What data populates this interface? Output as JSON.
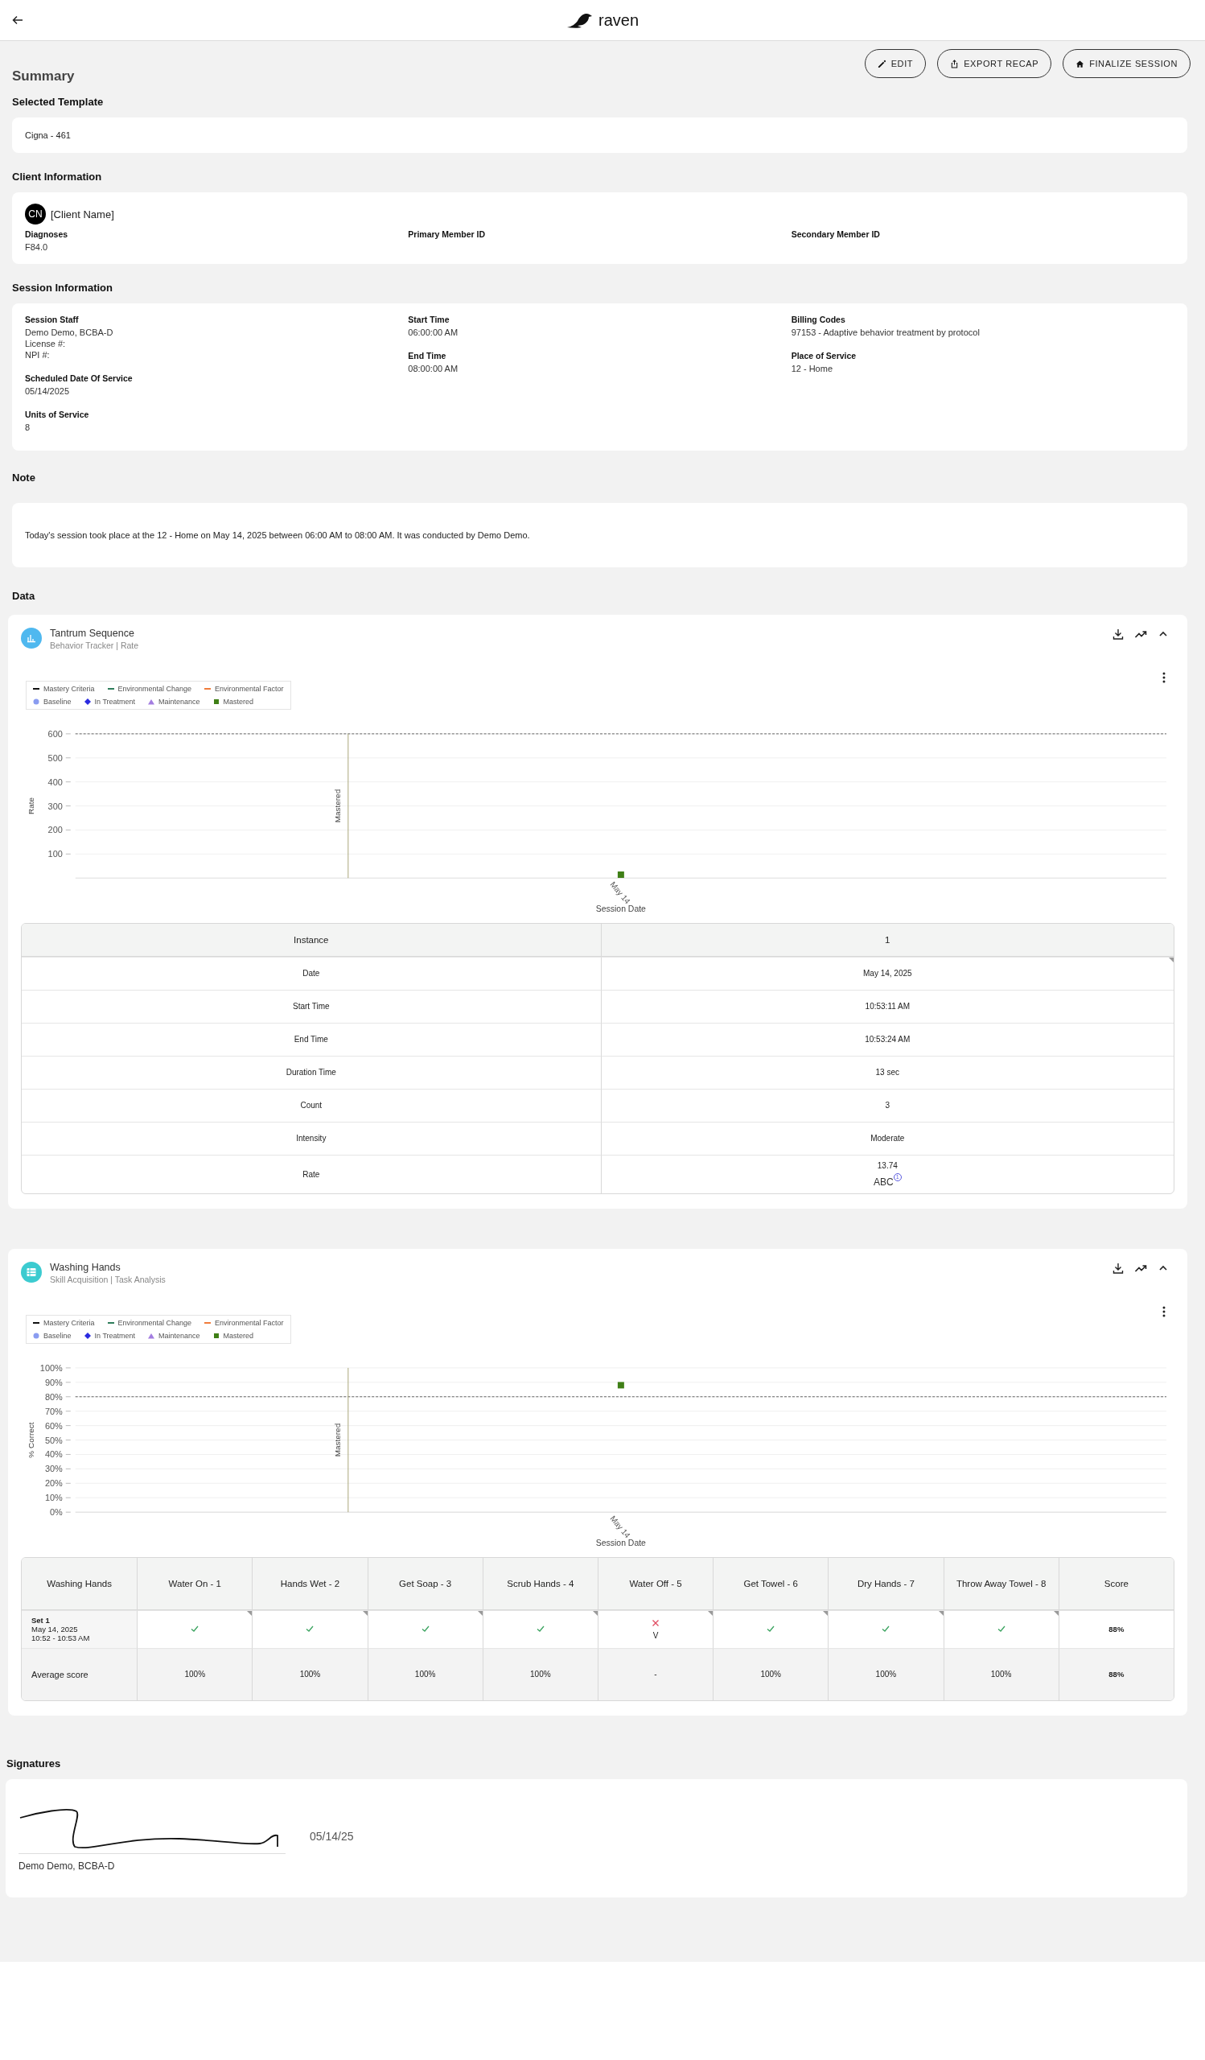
{
  "header": {
    "brand": "raven"
  },
  "actions": [
    {
      "label": "EDIT"
    },
    {
      "label": "EXPORT RECAP"
    },
    {
      "label": "FINALIZE SESSION"
    }
  ],
  "page_title": "Summary",
  "selected_template": {
    "heading": "Selected Template",
    "value": "Cigna - 461"
  },
  "client": {
    "heading": "Client Information",
    "initials": "CN",
    "name": "[Client Name]",
    "fields": [
      {
        "label": "Diagnoses",
        "lines": [
          "F84.0"
        ]
      },
      {
        "label": "Primary Member ID"
      },
      {
        "label": "Secondary Member ID"
      }
    ]
  },
  "session": {
    "heading": "Session Information",
    "columns": [
      {
        "fields": [
          {
            "label": "Session Staff",
            "lines": [
              "Demo Demo, BCBA-D",
              "License #:",
              "NPI #:"
            ]
          },
          {
            "label": "Scheduled Date Of Service",
            "lines": [
              "05/14/2025"
            ]
          },
          {
            "label": "Units of Service",
            "lines": [
              "8"
            ]
          }
        ]
      },
      {
        "fields": [
          {
            "label": "Start Time",
            "lines": [
              "06:00:00 AM"
            ]
          },
          {
            "label": "End Time",
            "lines": [
              "08:00:00 AM"
            ]
          }
        ]
      },
      {
        "fields": [
          {
            "label": "Billing Codes",
            "lines": [
              "97153 - Adaptive behavior treatment by protocol"
            ]
          },
          {
            "label": "Place of Service",
            "lines": [
              "12 - Home"
            ]
          }
        ]
      }
    ]
  },
  "note": {
    "heading": "Note",
    "text": "Today's session took place at the 12 - Home on May 14, 2025 between 06:00 AM to 08:00 AM. It was conducted by Demo Demo."
  },
  "data": {
    "heading": "Data",
    "trackers": [
      {
        "kind": "behavior",
        "title": "Tantrum Sequence",
        "subtitle": "Behavior Tracker | Rate",
        "legend": [
          [
            {
              "kind": "line",
              "label": "Mastery Criteria",
              "color": "#111111"
            },
            {
              "kind": "line",
              "label": "Environmental Change",
              "color": "#2e7d5b"
            },
            {
              "kind": "line",
              "label": "Environmental Factor",
              "color": "#f07c3c"
            }
          ],
          [
            {
              "kind": "circle",
              "label": "Baseline",
              "color": "#8a9cf0"
            },
            {
              "kind": "diamond",
              "label": "In Treatment",
              "color": "#2a2ae0"
            },
            {
              "kind": "triangle",
              "label": "Maintenance",
              "color": "#a37de0"
            },
            {
              "kind": "square",
              "label": "Mastered",
              "color": "#3f7f16"
            }
          ]
        ],
        "chart_data": {
          "type": "scatter",
          "xlabel": "Session Date",
          "ylabel": "Rate",
          "categories": [
            "May 14"
          ],
          "series": [
            {
              "color": "#3f7f16",
              "values": [
                14
              ]
            }
          ],
          "ylim": [
            0,
            600
          ],
          "yticks": [
            100,
            200,
            300,
            400,
            500,
            600
          ],
          "grid": true,
          "ref_lines": [
            {
              "axis": "y",
              "value": 600
            }
          ],
          "annotations": [
            {
              "text": "Mastered"
            }
          ]
        },
        "table": {
          "kind": "instances",
          "columns": [
            "Instance",
            "1"
          ],
          "rows": [
            {
              "label": "Date",
              "value": "May 14, 2025",
              "flagged": true
            },
            {
              "label": "Start Time",
              "value": "10:53:11 AM",
              "flagged": false
            },
            {
              "label": "End Time",
              "value": "10:53:24 AM",
              "flagged": false
            },
            {
              "label": "Duration Time",
              "value": "13 sec",
              "flagged": false
            },
            {
              "label": "Count",
              "value": "3",
              "flagged": false
            },
            {
              "label": "Intensity",
              "value": "Moderate",
              "flagged": false
            },
            {
              "label": "Rate",
              "value": "13.74",
              "tag": "ABC",
              "tag_count": "1",
              "flagged": false
            }
          ]
        }
      },
      {
        "kind": "skill",
        "title": "Washing Hands",
        "subtitle": "Skill Acquisition | Task Analysis",
        "legend": [
          [
            {
              "kind": "line",
              "label": "Mastery Criteria",
              "color": "#111111"
            },
            {
              "kind": "line",
              "label": "Environmental Change",
              "color": "#2e7d5b"
            },
            {
              "kind": "line",
              "label": "Environmental Factor",
              "color": "#f07c3c"
            }
          ],
          [
            {
              "kind": "circle",
              "label": "Baseline",
              "color": "#8a9cf0"
            },
            {
              "kind": "diamond",
              "label": "In Treatment",
              "color": "#2a2ae0"
            },
            {
              "kind": "triangle",
              "label": "Maintenance",
              "color": "#a37de0"
            },
            {
              "kind": "square",
              "label": "Mastered",
              "color": "#3f7f16"
            }
          ]
        ],
        "chart_data": {
          "type": "scatter",
          "xlabel": "Session Date",
          "ylabel": "% Correct",
          "categories": [
            "May 14"
          ],
          "series": [
            {
              "color": "#3f7f16",
              "values": [
                88
              ]
            }
          ],
          "ylim": [
            0,
            100
          ],
          "yticks": [
            {
              "value": 0,
              "label": "0%"
            },
            {
              "value": 10,
              "label": "10%"
            },
            {
              "value": 20,
              "label": "20%"
            },
            {
              "value": 30,
              "label": "30%"
            },
            {
              "value": 40,
              "label": "40%"
            },
            {
              "value": 50,
              "label": "50%"
            },
            {
              "value": 60,
              "label": "60%"
            },
            {
              "value": 70,
              "label": "70%"
            },
            {
              "value": 80,
              "label": "80%"
            },
            {
              "value": 90,
              "label": "90%"
            },
            {
              "value": 100,
              "label": "100%"
            }
          ],
          "grid": true,
          "ref_lines": [
            {
              "axis": "y",
              "value": 80
            }
          ],
          "annotations": [
            {
              "text": "Mastered"
            }
          ]
        },
        "table": {
          "kind": "steps",
          "columns": [
            "Washing Hands",
            "Water On - 1",
            "Hands Wet - 2",
            "Get Soap - 3",
            "Scrub Hands - 4",
            "Water Off - 5",
            "Get Towel - 6",
            "Dry Hands - 7",
            "Throw Away Towel - 8",
            "Score"
          ],
          "rows": [
            {
              "kind": "set",
              "cells": [
                {
                  "kind": "label",
                  "lines": [
                    "Set 1",
                    "May 14, 2025",
                    "10:52 - 10:53 AM"
                  ]
                },
                {
                  "kind": "correct",
                  "flagged": true
                },
                {
                  "kind": "correct",
                  "flagged": true
                },
                {
                  "kind": "correct",
                  "flagged": true
                },
                {
                  "kind": "correct",
                  "flagged": true
                },
                {
                  "kind": "incorrect",
                  "flagged": true,
                  "note": "V"
                },
                {
                  "kind": "correct",
                  "flagged": true
                },
                {
                  "kind": "correct",
                  "flagged": true
                },
                {
                  "kind": "correct",
                  "flagged": true
                },
                {
                  "kind": "score",
                  "text": "88%"
                }
              ]
            },
            {
              "kind": "average",
              "cells": [
                {
                  "kind": "label",
                  "lines": [
                    "Average score"
                  ]
                },
                {
                  "kind": "text",
                  "text": "100%"
                },
                {
                  "kind": "text",
                  "text": "100%"
                },
                {
                  "kind": "text",
                  "text": "100%"
                },
                {
                  "kind": "text",
                  "text": "100%"
                },
                {
                  "kind": "text",
                  "text": "-"
                },
                {
                  "kind": "text",
                  "text": "100%"
                },
                {
                  "kind": "text",
                  "text": "100%"
                },
                {
                  "kind": "text",
                  "text": "100%"
                },
                {
                  "kind": "score",
                  "text": "88%"
                }
              ]
            }
          ]
        }
      }
    ]
  },
  "signatures": {
    "heading": "Signatures",
    "items": [
      {
        "name": "Demo Demo, BCBA-D",
        "date": "05/14/25"
      }
    ]
  }
}
